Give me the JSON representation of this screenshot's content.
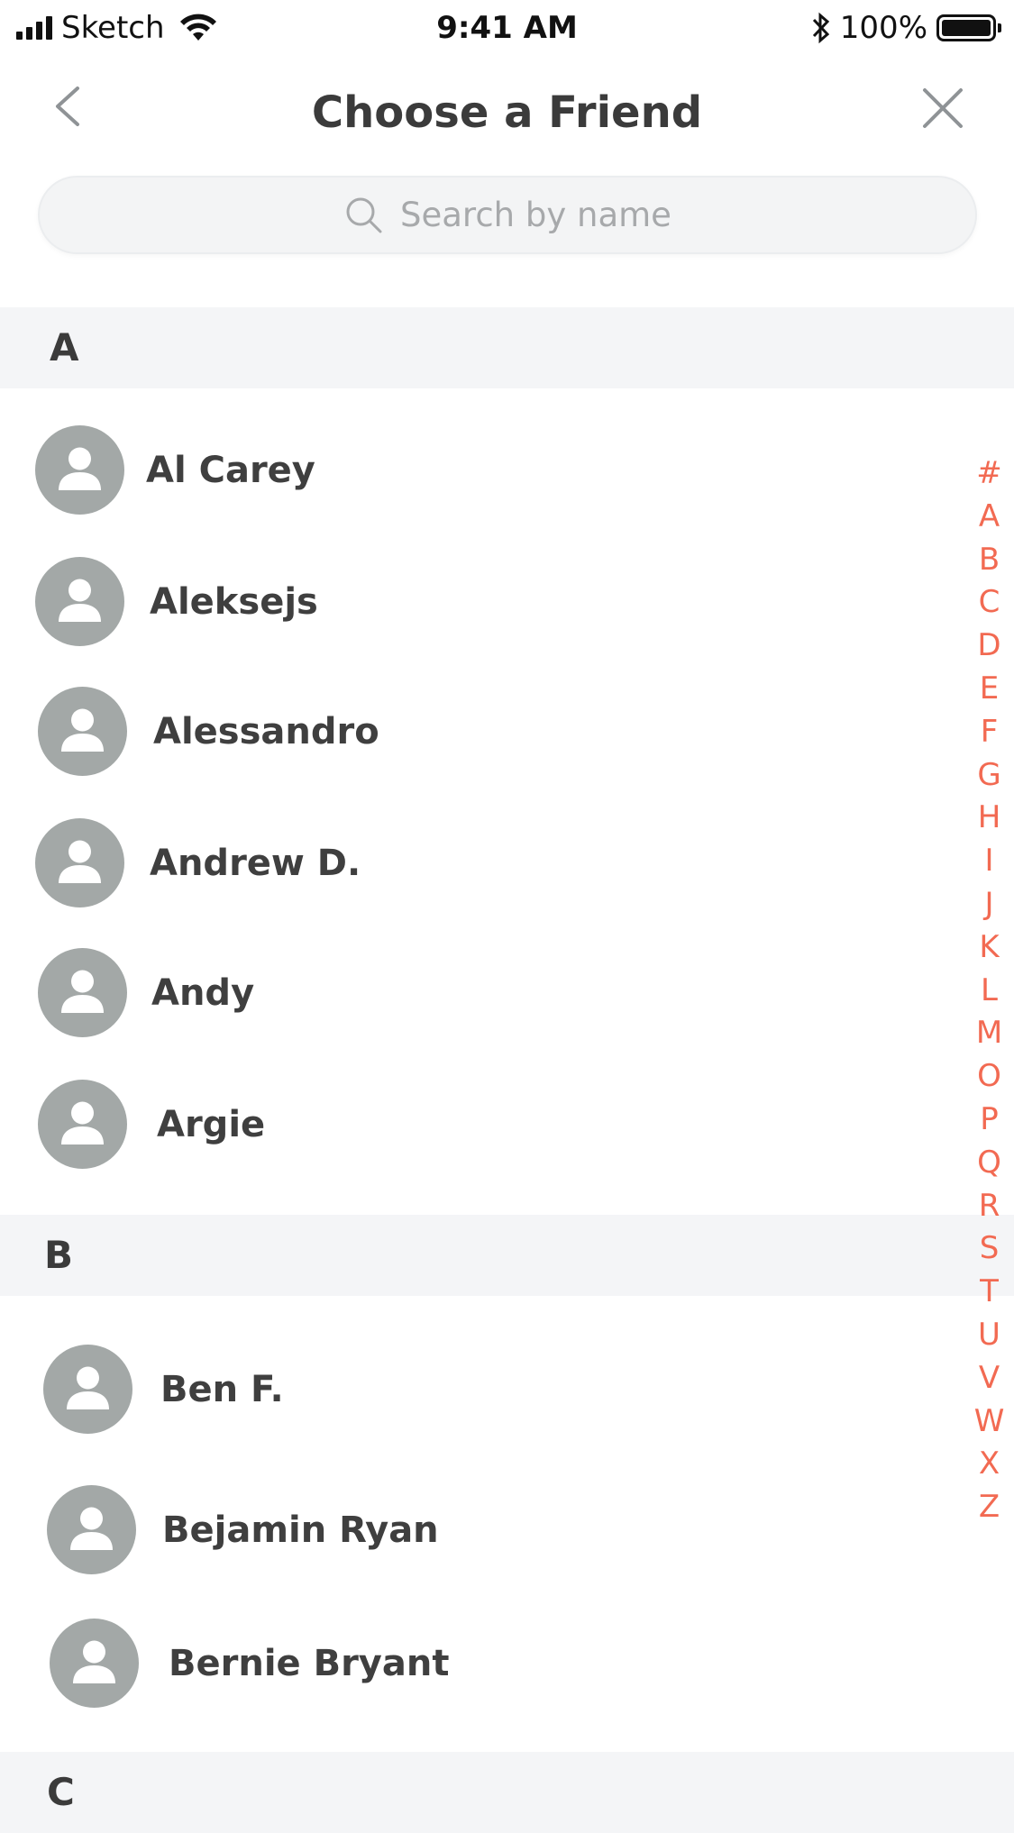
{
  "status_bar": {
    "carrier": "Sketch",
    "time": "9:41 AM",
    "battery": "100%",
    "battery_level": 1.0
  },
  "nav": {
    "title": "Choose a Friend",
    "back_icon": "chevron-left-icon",
    "close_icon": "close-icon"
  },
  "search": {
    "placeholder": "Search by name",
    "value": "",
    "icon": "search-icon"
  },
  "sections": [
    {
      "letter": "A",
      "contacts": [
        "Al Carey",
        "Aleksejs",
        "Alessandro",
        "Andrew D.",
        "Andy",
        "Argie"
      ]
    },
    {
      "letter": "B",
      "contacts": [
        "Ben F.",
        "Bejamin Ryan",
        "Bernie Bryant"
      ]
    },
    {
      "letter": "C",
      "contacts": []
    }
  ],
  "index_letters": [
    "#",
    "A",
    "B",
    "C",
    "D",
    "E",
    "F",
    "G",
    "H",
    "I",
    "J",
    "K",
    "L",
    "M",
    "O",
    "P",
    "Q",
    "R",
    "S",
    "T",
    "U",
    "V",
    "W",
    "X",
    "Z"
  ],
  "colors": {
    "accent": "#f26a52",
    "avatar": "#a3a8a7",
    "section_bg": "#f4f5f7",
    "search_bg": "#f3f4f5",
    "text": "#3d3d3d"
  }
}
